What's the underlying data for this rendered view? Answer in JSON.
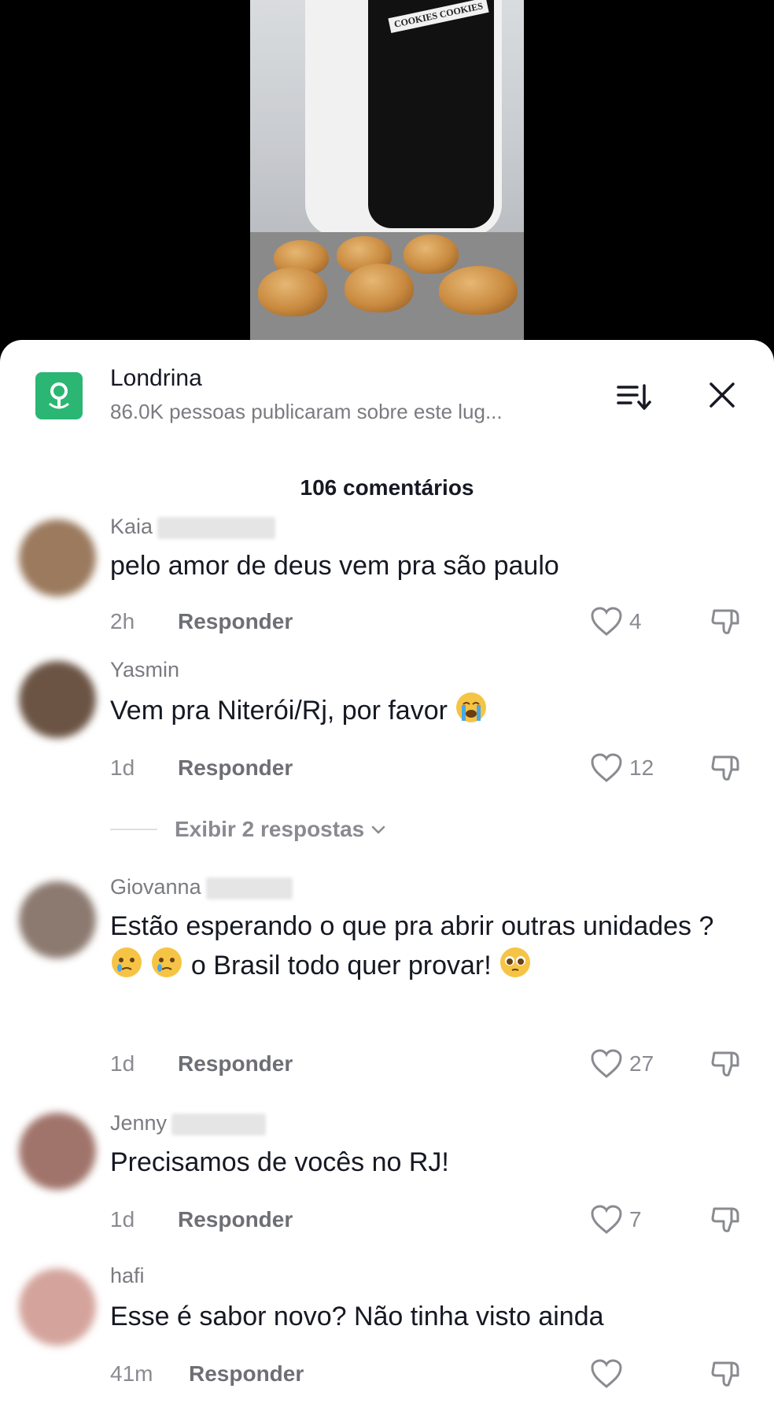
{
  "place": {
    "title": "Londrina",
    "subtitle": "86.0K pessoas publicaram sobre este lug...",
    "icon": "map-pin-icon",
    "icon_color": "#2bb673"
  },
  "header": {
    "sort_icon": "sort-icon",
    "close_icon": "close-icon"
  },
  "video": {
    "apron_text": "COOKIES COOKIES"
  },
  "comments_count": "106 comentários",
  "reply_label": "Responder",
  "comments": [
    {
      "user": "Kaia",
      "text": "pelo amor de deus vem pra são paulo",
      "time": "2h",
      "likes": "4",
      "avatar_color": "#9b7a5e"
    },
    {
      "user": "Yasmin",
      "text": "Vem pra Niterói/Rj, por favor",
      "emoji": [
        "loudly-crying-face"
      ],
      "time": "1d",
      "likes": "12",
      "avatar_color": "#6b5444"
    },
    {
      "user": "Giovanna",
      "text": "Estão esperando o que pra abrir outras unidades ?",
      "text_after": "o Brasil todo quer provar!",
      "emoji": [
        "face-holding-back-tears",
        "face-holding-back-tears",
        "pleading-face"
      ],
      "time": "1d",
      "likes": "27",
      "avatar_color": "#8c7a70"
    },
    {
      "user": "Jenny",
      "text": "Precisamos de vocês no RJ!",
      "time": "1d",
      "likes": "7",
      "avatar_color": "#a0746a"
    },
    {
      "user": "hafi",
      "text": "Esse é sabor novo? Não tinha visto ainda",
      "time": "41m",
      "likes": "",
      "avatar_color": "#d4a49c"
    }
  ],
  "show_replies": "Exibir 2 respostas"
}
